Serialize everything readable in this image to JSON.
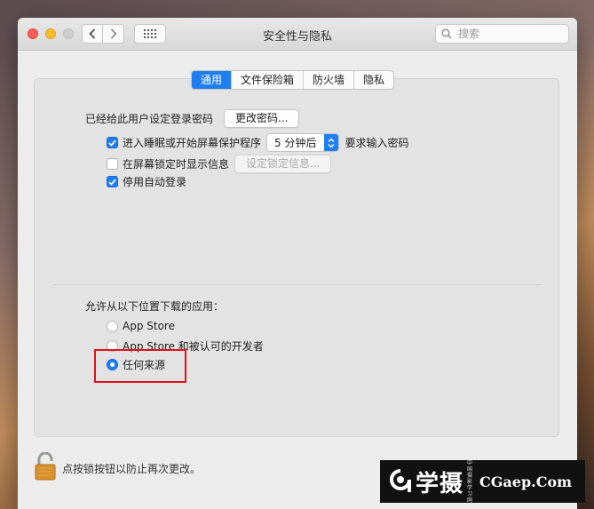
{
  "window": {
    "title": "安全性与隐私"
  },
  "search": {
    "placeholder": "搜索"
  },
  "tabs": [
    {
      "label": "通用",
      "active": true
    },
    {
      "label": "文件保险箱",
      "active": false
    },
    {
      "label": "防火墙",
      "active": false
    },
    {
      "label": "隐私",
      "active": false
    }
  ],
  "general": {
    "password_label": "已经给此用户设定登录密码",
    "change_password_button": "更改密码...",
    "require_password": {
      "checked": true,
      "label_before": "进入睡眠或开始屏幕保护程序",
      "delay": "5 分钟后",
      "label_after": "要求输入密码"
    },
    "show_message": {
      "checked": false,
      "label": "在屏幕锁定时显示信息",
      "button": "设定锁定信息..."
    },
    "disable_autologin": {
      "checked": true,
      "label": "停用自动登录"
    }
  },
  "downloads": {
    "title": "允许从以下位置下载的应用：",
    "options": [
      {
        "label": "App Store",
        "selected": false
      },
      {
        "label": "App Store 和被认可的开发者",
        "selected": false
      },
      {
        "label": "任何来源",
        "selected": true
      }
    ]
  },
  "footer": {
    "lock_text": "点按锁按钮以防止再次更改。"
  },
  "watermark": {
    "brand_cn": "学摄",
    "vertical_text": "中国摄影学习网",
    "domain": "CGaep.Com"
  },
  "colors": {
    "accent": "#1f7ff2",
    "highlight": "#e3101e"
  }
}
